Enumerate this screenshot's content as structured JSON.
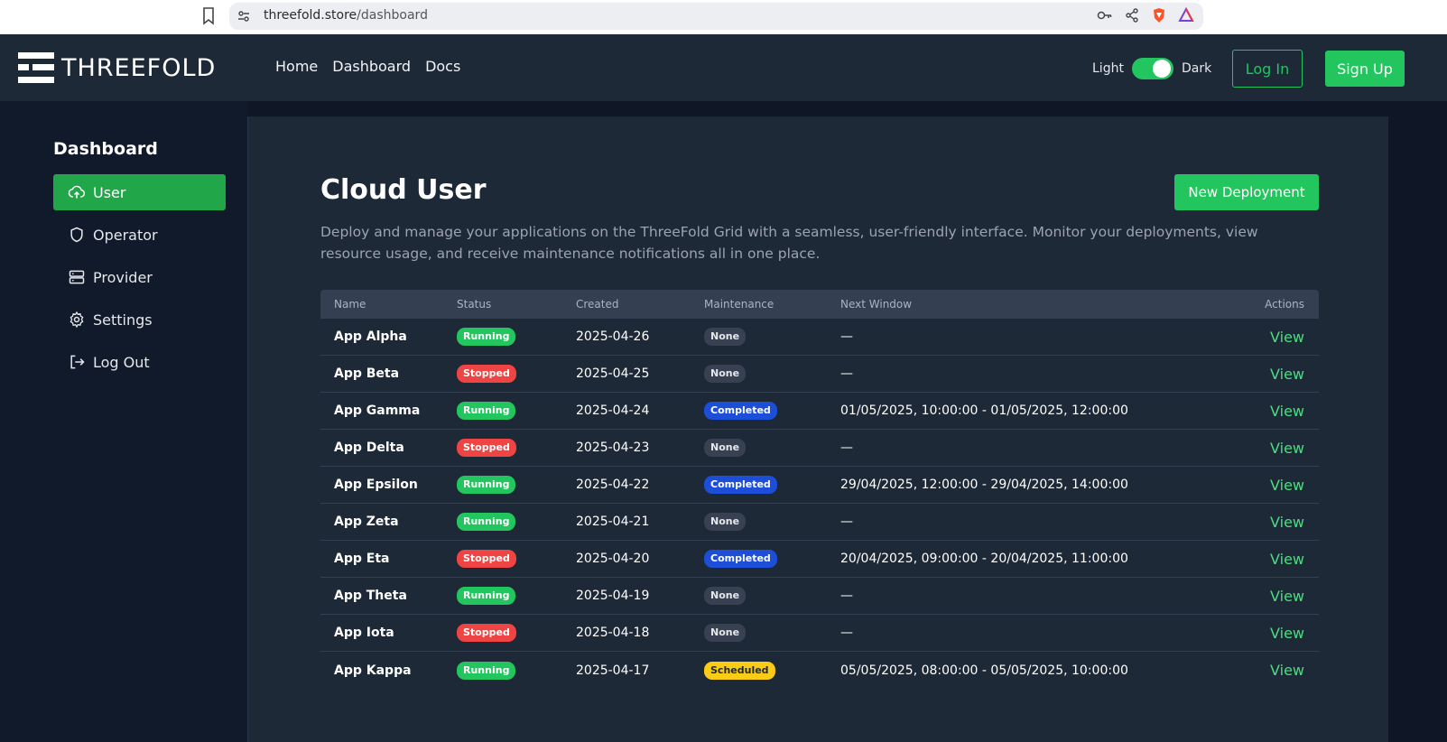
{
  "browser": {
    "url_host": "threefold.store",
    "url_path": "/dashboard"
  },
  "header": {
    "logo_text": "THREEFOLD",
    "nav": [
      "Home",
      "Dashboard",
      "Docs"
    ],
    "theme_light": "Light",
    "theme_dark": "Dark",
    "theme_dark_enabled": true,
    "login_label": "Log In",
    "signup_label": "Sign Up"
  },
  "sidebar": {
    "title": "Dashboard",
    "items": [
      {
        "label": "User",
        "icon": "cloud-upload-icon",
        "active": true
      },
      {
        "label": "Operator",
        "icon": "shield-icon",
        "active": false
      },
      {
        "label": "Provider",
        "icon": "server-icon",
        "active": false
      },
      {
        "label": "Settings",
        "icon": "gear-icon",
        "active": false
      },
      {
        "label": "Log Out",
        "icon": "logout-icon",
        "active": false
      }
    ]
  },
  "main": {
    "title": "Cloud User",
    "new_deployment_label": "New Deployment",
    "description": "Deploy and manage your applications on the ThreeFold Grid with a seamless, user-friendly interface. Monitor your deployments, view resource usage, and receive maintenance notifications all in one place."
  },
  "table": {
    "columns": [
      "Name",
      "Status",
      "Created",
      "Maintenance",
      "Next Window",
      "Actions"
    ],
    "rows": [
      {
        "name": "App Alpha",
        "status": "Running",
        "created": "2025-04-26",
        "maintenance": "None",
        "window": "—",
        "action": "View"
      },
      {
        "name": "App Beta",
        "status": "Stopped",
        "created": "2025-04-25",
        "maintenance": "None",
        "window": "—",
        "action": "View"
      },
      {
        "name": "App Gamma",
        "status": "Running",
        "created": "2025-04-24",
        "maintenance": "Completed",
        "window": "01/05/2025, 10:00:00 - 01/05/2025, 12:00:00",
        "action": "View"
      },
      {
        "name": "App Delta",
        "status": "Stopped",
        "created": "2025-04-23",
        "maintenance": "None",
        "window": "—",
        "action": "View"
      },
      {
        "name": "App Epsilon",
        "status": "Running",
        "created": "2025-04-22",
        "maintenance": "Completed",
        "window": "29/04/2025, 12:00:00 - 29/04/2025, 14:00:00",
        "action": "View"
      },
      {
        "name": "App Zeta",
        "status": "Running",
        "created": "2025-04-21",
        "maintenance": "None",
        "window": "—",
        "action": "View"
      },
      {
        "name": "App Eta",
        "status": "Stopped",
        "created": "2025-04-20",
        "maintenance": "Completed",
        "window": "20/04/2025, 09:00:00 - 20/04/2025, 11:00:00",
        "action": "View"
      },
      {
        "name": "App Theta",
        "status": "Running",
        "created": "2025-04-19",
        "maintenance": "None",
        "window": "—",
        "action": "View"
      },
      {
        "name": "App Iota",
        "status": "Stopped",
        "created": "2025-04-18",
        "maintenance": "None",
        "window": "—",
        "action": "View"
      },
      {
        "name": "App Kappa",
        "status": "Running",
        "created": "2025-04-17",
        "maintenance": "Scheduled",
        "window": "05/05/2025, 08:00:00 - 05/05/2025, 10:00:00",
        "action": "View"
      }
    ]
  },
  "colors": {
    "accent": "#22c55e",
    "danger": "#ef4444",
    "info": "#1d4ed8",
    "warning": "#facc15",
    "panel": "#1e2938",
    "background": "#0f1726"
  }
}
